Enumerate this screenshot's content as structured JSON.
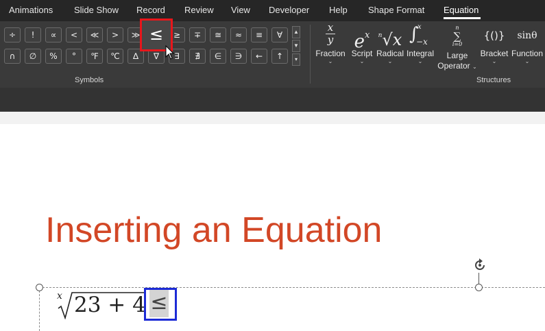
{
  "ribbon": {
    "tabs": [
      {
        "label": "Animations"
      },
      {
        "label": "Slide Show"
      },
      {
        "label": "Record"
      },
      {
        "label": "Review"
      },
      {
        "label": "View"
      },
      {
        "label": "Developer"
      },
      {
        "label": "Help"
      },
      {
        "label": "Shape Format"
      },
      {
        "label": "Equation",
        "active": true
      }
    ],
    "symbols": {
      "row1": [
        "÷",
        "!",
        "∝",
        "<",
        "≪",
        ">",
        "≫",
        "≤",
        "≥",
        "∓",
        "≅",
        "≈",
        "≡",
        "∀"
      ],
      "row2": [
        "∩",
        "∅",
        "%",
        "°",
        "℉",
        "℃",
        "∆",
        "∇",
        "∃",
        "∄",
        "∈",
        "∋",
        "←",
        "↑"
      ],
      "highlighted": "≤",
      "group_label": "Symbols"
    },
    "structures": {
      "group_label": "Structures",
      "items": [
        {
          "label": "Fraction"
        },
        {
          "label": "Script"
        },
        {
          "label": "Radical"
        },
        {
          "label": "Integral"
        },
        {
          "label": "Large",
          "label2": "Operator"
        },
        {
          "label": "Bracket"
        },
        {
          "label": "Function"
        }
      ],
      "glyphs": {
        "fraction_num": "x",
        "fraction_den": "y",
        "script_base": "e",
        "script_sup": "x",
        "radical_index": "n",
        "radical_body": "x",
        "integral_upper": "x",
        "integral_lower": "−x",
        "sum_upper": "n",
        "sum_lower": "i=0",
        "bracket": "{()}",
        "function": "sinθ"
      }
    }
  },
  "slide": {
    "title": "Inserting an Equation",
    "equation": {
      "index": "x",
      "radicand": "23 + 4",
      "inserted_symbol": "≤"
    }
  },
  "colors": {
    "title": "#d24726",
    "highlight_red": "#e8161b",
    "selection_blue": "#1c2bd6"
  }
}
